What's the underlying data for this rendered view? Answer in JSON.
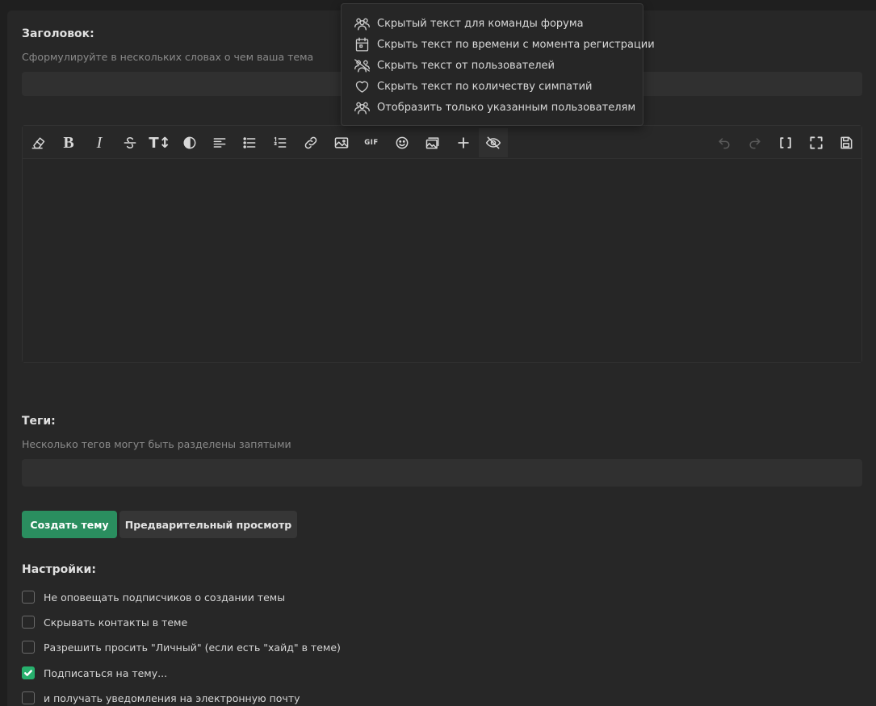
{
  "title_field": {
    "label": "Заголовок:",
    "hint": "Сформулируйте в нескольких словах о чем ваша тема",
    "value": ""
  },
  "editor": {
    "toolbar_icons": [
      "eraser-icon",
      "bold-icon",
      "italic-icon",
      "strikethrough-icon",
      "text-size-icon",
      "color-icon",
      "align-icon",
      "bullet-list-icon",
      "numbered-list-icon",
      "link-icon",
      "image-icon",
      "gif-icon",
      "smiley-icon",
      "media-icon",
      "plus-icon",
      "hide-icon",
      "undo-icon",
      "redo-icon",
      "bbcode-icon",
      "fullscreen-icon",
      "save-draft-icon"
    ],
    "gif_label": "GIF",
    "bold_glyph": "B",
    "italic_glyph": "I",
    "textsize_glyph": "T↕",
    "content": ""
  },
  "hide_menu": {
    "items": [
      {
        "icon": "team-icon",
        "label": "Скрытый текст для команды форума"
      },
      {
        "icon": "calendar-icon",
        "label": "Скрыть текст по времени с момента регистрации"
      },
      {
        "icon": "users-slash-icon",
        "label": "Скрыть текст от пользователей"
      },
      {
        "icon": "heart-icon",
        "label": "Скрыть текст по количеству симпатий"
      },
      {
        "icon": "users-icon",
        "label": "Отобразить только указанным пользователям"
      }
    ]
  },
  "tags_field": {
    "label": "Теги:",
    "hint": "Несколько тегов могут быть разделены запятыми",
    "value": ""
  },
  "actions": {
    "create_label": "Создать тему",
    "preview_label": "Предварительный просмотр"
  },
  "settings": {
    "label": "Настройки:",
    "options": [
      {
        "label": "Не оповещать подписчиков о создании темы",
        "checked": false
      },
      {
        "label": "Скрывать контакты в теме",
        "checked": false
      },
      {
        "label": "Разрешить просить \"Личный\" (если есть \"хайд\" в теме)",
        "checked": false
      },
      {
        "label": "Подписаться на тему...",
        "checked": true
      },
      {
        "label": "и получать уведомления на электронную почту",
        "checked": false
      }
    ]
  },
  "colors": {
    "background": "#1f1f1f",
    "panel": "#272727",
    "primary_button": "#2a8e5f",
    "checkbox_checked": "#27b06d"
  }
}
